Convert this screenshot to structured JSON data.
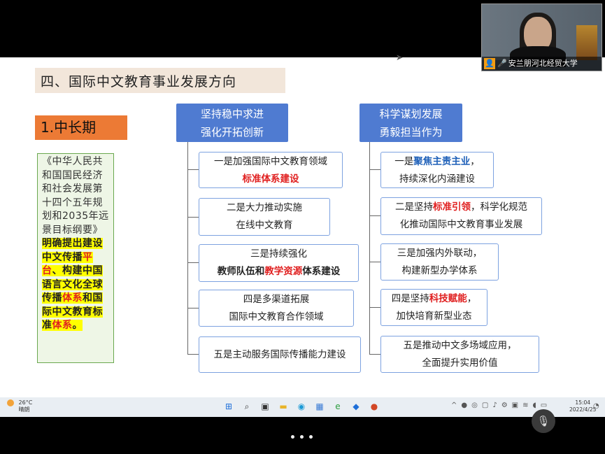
{
  "slide": {
    "title": "四、国际中文教育事业发展方向",
    "section_badge": "1.中长期",
    "textbox": {
      "plain": "《中华人民共和国国民经济和社会发展第十四个五年规划和2035年远景目标纲要》",
      "hl1": "明确提出建设中文传播",
      "hl2_red": "平台",
      "hl3": "、构建中国语言文化全球传播",
      "hl4_red": "体系",
      "hl5": "和国际中文教育标准",
      "hl6_red": "体系",
      "hl7": "。"
    },
    "left_branch": {
      "header_line1": "坚持稳中求进",
      "header_line2": "强化开拓创新",
      "items": [
        {
          "line1": "一是加强国际中文教育领域",
          "line2_red": "标准体系建设"
        },
        {
          "line1": "二是大力推动实施",
          "line2": "在线中文教育"
        },
        {
          "line1": "三是持续强化",
          "line2_a": "教师队伍和",
          "line2_red": "教学资源",
          "line2_b": "体系建设"
        },
        {
          "line1": "四是多渠道拓展",
          "line2": "国际中文教育合作领域"
        },
        {
          "line1": "五是主动服务国际传播能力建设"
        }
      ]
    },
    "right_branch": {
      "header_line1": "科学谋划发展",
      "header_line2": "勇毅担当作为",
      "items": [
        {
          "line1_a": "一是",
          "line1_blue": "聚焦主责主业",
          "line1_b": "，",
          "line2": "持续深化内涵建设"
        },
        {
          "line1_a": "二是坚持",
          "line1_red": "标准引领",
          "line1_b": "，科学化规范",
          "line2": "化推动国际中文教育事业发展"
        },
        {
          "line1": "三是加强内外联动，",
          "line2": "构建新型办学体系"
        },
        {
          "line1_a": "四是坚持",
          "line1_red": "科技赋能",
          "line1_b": "，",
          "line2": "加快培育新型业态"
        },
        {
          "line1": "五是推动中文多场域应用，",
          "line2": "全面提升实用价值"
        }
      ]
    }
  },
  "video": {
    "caption": "安兰朋河北经贸大学",
    "icon": "user-icon",
    "mic": "microphone-icon"
  },
  "taskbar": {
    "weather_temp": "26°C",
    "weather_desc": "晴朗",
    "clock_time": "15:04",
    "clock_date": "2022/4/25"
  },
  "colors": {
    "header_blue": "#4f7bd1",
    "badge_orange": "#ec7a35",
    "title_bg": "#f2e6da",
    "highlight_red": "#e02020",
    "highlight_blue": "#1d5fb8",
    "highlight_yellow": "#ffff00"
  }
}
